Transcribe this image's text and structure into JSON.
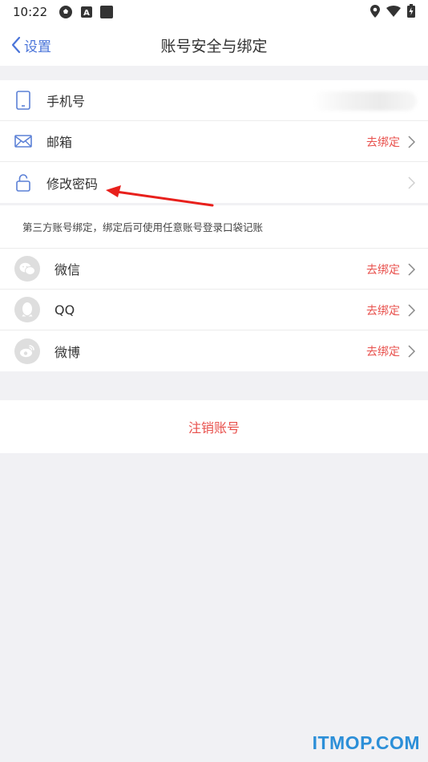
{
  "status_bar": {
    "time": "10:22",
    "icons": [
      "soccer-ball-icon",
      "a-box-icon",
      "square-icon",
      "location-icon",
      "wifi-icon",
      "battery-icon"
    ]
  },
  "nav": {
    "back_label": "设置",
    "title": "账号安全与绑定"
  },
  "account_rows": [
    {
      "label": "手机号",
      "icon": "phone-icon",
      "action": ""
    },
    {
      "label": "邮箱",
      "icon": "mail-icon",
      "action": "去绑定"
    },
    {
      "label": "修改密码",
      "icon": "lock-icon",
      "action": ""
    }
  ],
  "third_party": {
    "note": "第三方账号绑定，绑定后可使用任意账号登录口袋记账",
    "items": [
      {
        "label": "微信",
        "icon": "wechat-icon",
        "action": "去绑定"
      },
      {
        "label": "QQ",
        "icon": "qq-icon",
        "action": "去绑定"
      },
      {
        "label": "微博",
        "icon": "weibo-icon",
        "action": "去绑定"
      }
    ]
  },
  "logout_label": "注销账号",
  "watermark": "ITMOP.COM",
  "colors": {
    "accent_red": "#e8504c",
    "link_blue": "#4a74d9",
    "icon_blue": "#5b80d6",
    "background": "#f1f1f4",
    "watermark": "#2c8fd8"
  }
}
